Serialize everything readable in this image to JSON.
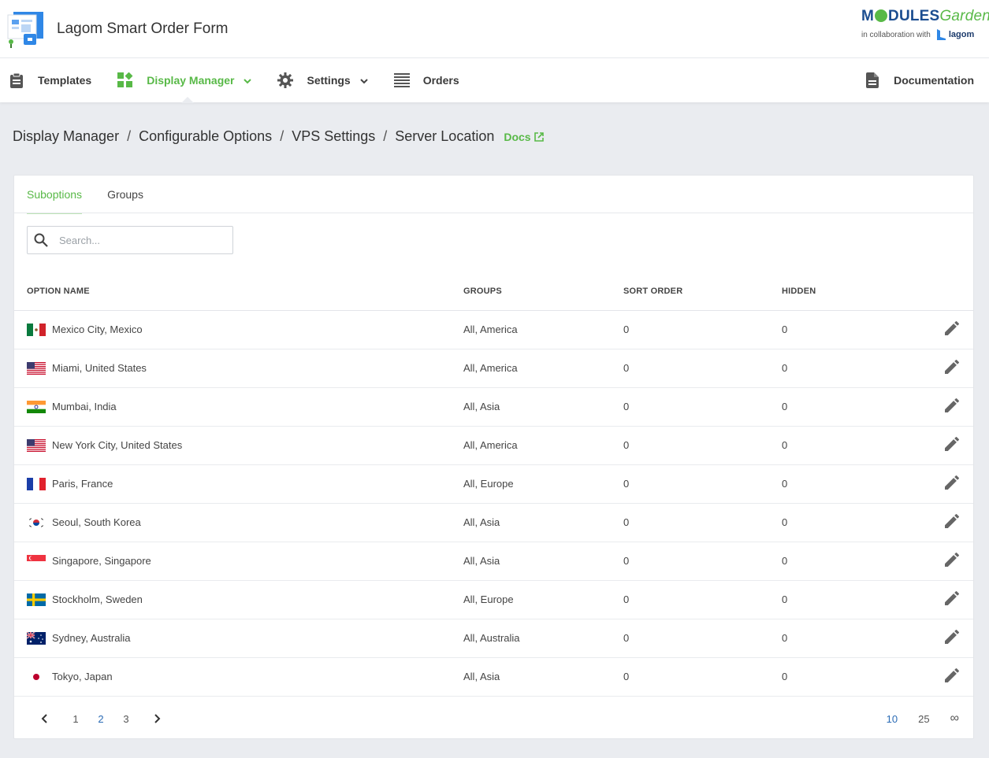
{
  "header": {
    "app_title": "Lagom Smart Order Form",
    "brand_top_a": "M",
    "brand_top_b": "DULES",
    "brand_top_c": "Garden",
    "brand_collab": "in collaboration with",
    "brand_partner": "lagom"
  },
  "nav": {
    "items": [
      {
        "label": "Templates",
        "icon": "clipboard-icon"
      },
      {
        "label": "Display Manager",
        "icon": "widgets-icon"
      },
      {
        "label": "Settings",
        "icon": "gear-icon"
      },
      {
        "label": "Orders",
        "icon": "list-icon"
      }
    ],
    "right_label": "Documentation",
    "accent": "#58b947"
  },
  "breadcrumb": {
    "items": [
      "Display Manager",
      "Configurable Options",
      "VPS Settings",
      "Server Location"
    ],
    "separator": "/",
    "docs_label": "Docs"
  },
  "tabs": [
    "Suboptions",
    "Groups"
  ],
  "search": {
    "placeholder": "Search..."
  },
  "table": {
    "headers": [
      "OPTION NAME",
      "GROUPS",
      "SORT ORDER",
      "HIDDEN"
    ],
    "rows": [
      {
        "name": "Mexico City, Mexico",
        "flag": "mx",
        "groups": "All, America",
        "sort": "0",
        "hidden": "0"
      },
      {
        "name": "Miami, United States",
        "flag": "us",
        "groups": "All, America",
        "sort": "0",
        "hidden": "0"
      },
      {
        "name": "Mumbai, India",
        "flag": "in",
        "groups": "All, Asia",
        "sort": "0",
        "hidden": "0"
      },
      {
        "name": "New York City, United States",
        "flag": "us",
        "groups": "All, America",
        "sort": "0",
        "hidden": "0"
      },
      {
        "name": "Paris, France",
        "flag": "fr",
        "groups": "All, Europe",
        "sort": "0",
        "hidden": "0"
      },
      {
        "name": "Seoul, South Korea",
        "flag": "kr",
        "groups": "All, Asia",
        "sort": "0",
        "hidden": "0"
      },
      {
        "name": "Singapore, Singapore",
        "flag": "sg",
        "groups": "All, Asia",
        "sort": "0",
        "hidden": "0"
      },
      {
        "name": "Stockholm, Sweden",
        "flag": "se",
        "groups": "All, Europe",
        "sort": "0",
        "hidden": "0"
      },
      {
        "name": "Sydney, Australia",
        "flag": "au",
        "groups": "All, Australia",
        "sort": "0",
        "hidden": "0"
      },
      {
        "name": "Tokyo, Japan",
        "flag": "jp",
        "groups": "All, Asia",
        "sort": "0",
        "hidden": "0"
      }
    ]
  },
  "pagination": {
    "pages": [
      "1",
      "2",
      "3"
    ],
    "current_page": "2",
    "per_page": [
      "10",
      "25",
      "∞"
    ],
    "current_per_page": "10"
  }
}
